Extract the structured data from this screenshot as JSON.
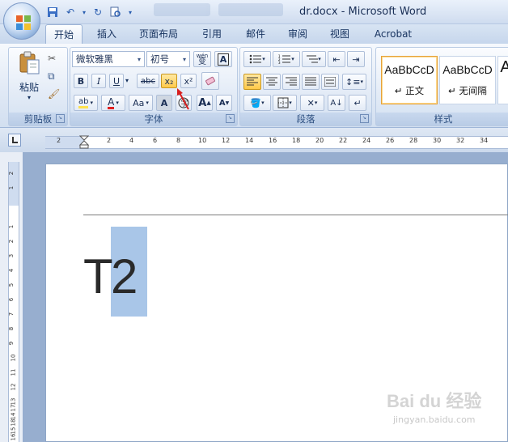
{
  "window": {
    "title": "dr.docx - Microsoft Word"
  },
  "tabs": [
    {
      "label": "开始",
      "active": true
    },
    {
      "label": "插入"
    },
    {
      "label": "页面布局"
    },
    {
      "label": "引用"
    },
    {
      "label": "邮件"
    },
    {
      "label": "审阅"
    },
    {
      "label": "视图"
    },
    {
      "label": "Acrobat"
    }
  ],
  "ribbon": {
    "clipboard": {
      "label": "剪贴板",
      "paste_label": "粘贴"
    },
    "font": {
      "label": "字体",
      "font_name": "微软雅黑",
      "font_size": "初号",
      "wen_label": "wén",
      "wen_char": "变",
      "bold": "B",
      "italic": "I",
      "underline": "U",
      "strike": "abc",
      "subscript": "x₂",
      "superscript": "x²",
      "grow": "A",
      "shrink": "A",
      "case": "Aa",
      "char_shade": "A",
      "font_color": "A",
      "highlight": "ab"
    },
    "paragraph": {
      "label": "段落"
    },
    "styles": {
      "label": "样式",
      "cards": [
        {
          "sample": "AaBbCcD",
          "name": "↵ 正文"
        },
        {
          "sample": "AaBbCcD",
          "name": "↵ 无间隔"
        },
        {
          "sample": "A",
          "name": ""
        }
      ]
    }
  },
  "ruler": {
    "h_labels": [
      "2",
      "2",
      "4",
      "6",
      "8",
      "10",
      "12",
      "14",
      "16",
      "18",
      "20",
      "22",
      "24",
      "26",
      "28",
      "30",
      "32",
      "34"
    ],
    "v_labels": [
      "2",
      "1",
      "1",
      "2",
      "3",
      "4",
      "5",
      "6",
      "7",
      "8",
      "9",
      "10",
      "11",
      "12",
      "13",
      "14",
      "15",
      "16",
      "17",
      "18"
    ]
  },
  "document": {
    "char_1": "T",
    "char_2": "2"
  },
  "watermark": {
    "brand": "Bai du 经验",
    "sub": "jingyan.baidu.com"
  },
  "colors": {
    "accent": "#2a5db0",
    "selection": "#a9c6e8",
    "highlight_yellow": "#ffe14d",
    "font_red": "#e02020"
  }
}
